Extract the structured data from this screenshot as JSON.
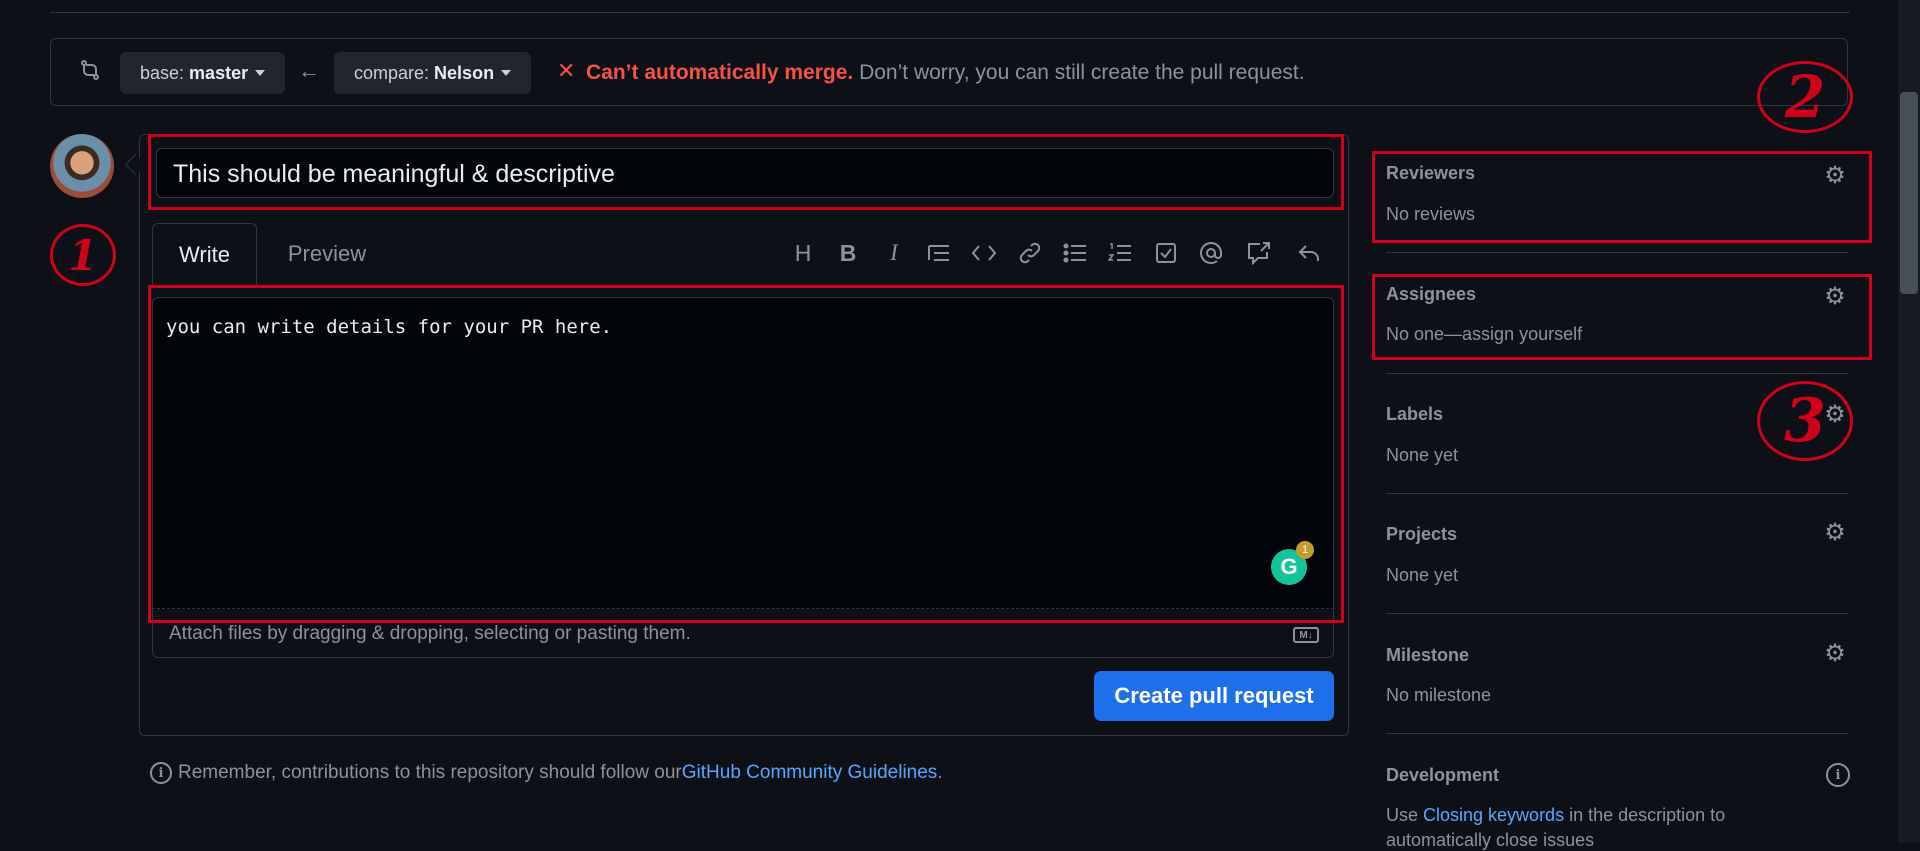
{
  "compare": {
    "base_prefix": "base:",
    "base_branch": "master",
    "compare_prefix": "compare:",
    "compare_branch": "Nelson",
    "merge_status_bold": "Can’t automatically merge.",
    "merge_status_text": " Don’t worry, you can still create the pull request."
  },
  "editor": {
    "title_value": "This should be meaningful & descriptive",
    "tab_write": "Write",
    "tab_preview": "Preview",
    "body_value": "you can write details for your PR here.",
    "attach_text": "Attach files by dragging & dropping, selecting or pasting them.",
    "markdown_badge": "M↓",
    "grammarly_count": "1",
    "create_button": "Create pull request",
    "toolbar_icons": [
      "heading-icon",
      "bold-icon",
      "italic-icon",
      "quote-icon",
      "code-icon",
      "link-icon",
      "bulleted-list-icon",
      "numbered-list-icon",
      "task-list-icon",
      "mention-icon",
      "reference-icon",
      "reply-icon"
    ]
  },
  "footer": {
    "remember_text": "Remember, contributions to this repository should follow our ",
    "guidelines_link": "GitHub Community Guidelines",
    "period": "."
  },
  "sidebar": {
    "reviewers": {
      "title": "Reviewers",
      "value": "No reviews"
    },
    "assignees": {
      "title": "Assignees",
      "value": "No one—assign yourself"
    },
    "labels": {
      "title": "Labels",
      "value": "None yet"
    },
    "projects": {
      "title": "Projects",
      "value": "None yet"
    },
    "milestone": {
      "title": "Milestone",
      "value": "No milestone"
    },
    "development": {
      "title": "Development",
      "value_prefix": "Use ",
      "value_link": "Closing keywords",
      "value_suffix": " in the description to",
      "value_line2": "automatically close issues"
    }
  },
  "annotations": {
    "one": "1",
    "two": "2",
    "three": "3"
  },
  "colors": {
    "background": "#0d1117",
    "accent_blue": "#1f6feb",
    "link_blue": "#58a6ff",
    "error_red": "#f85149",
    "annotation_red": "#d0021b"
  }
}
